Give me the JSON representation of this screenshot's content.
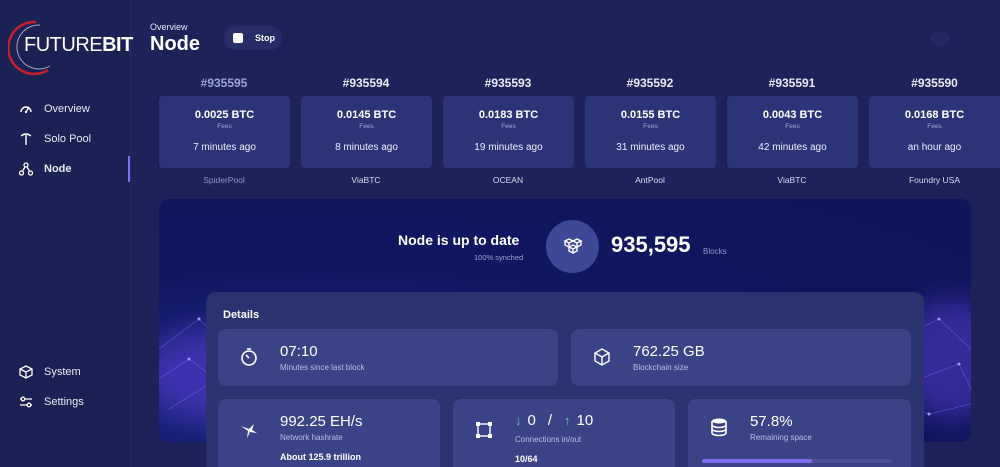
{
  "logo": {
    "text_light": "FUTURE",
    "text_bold": "BIT"
  },
  "sidebar": {
    "items": [
      {
        "label": "Overview",
        "icon": "gauge-icon"
      },
      {
        "label": "Solo Pool",
        "icon": "pickaxe-icon"
      },
      {
        "label": "Node",
        "icon": "network-icon",
        "active": true
      },
      {
        "label": "System",
        "icon": "cube-icon"
      },
      {
        "label": "Settings",
        "icon": "sliders-icon"
      }
    ]
  },
  "header": {
    "breadcrumb": "Overview",
    "title": "Node",
    "stop_label": "Stop"
  },
  "blocks": [
    {
      "number": "#935595",
      "amount": "0.0025 BTC",
      "fees_label": "Fees",
      "time": "7 minutes ago",
      "pool": "SpiderPool"
    },
    {
      "number": "#935594",
      "amount": "0.0145 BTC",
      "fees_label": "Fees",
      "time": "8 minutes ago",
      "pool": "ViaBTC"
    },
    {
      "number": "#935593",
      "amount": "0.0183 BTC",
      "fees_label": "Fees",
      "time": "19 minutes ago",
      "pool": "OCEAN"
    },
    {
      "number": "#935592",
      "amount": "0.0155 BTC",
      "fees_label": "Fees",
      "time": "31 minutes ago",
      "pool": "AntPool"
    },
    {
      "number": "#935591",
      "amount": "0.0043 BTC",
      "fees_label": "Fees",
      "time": "42 minutes ago",
      "pool": "ViaBTC"
    },
    {
      "number": "#935590",
      "amount": "0.0168 BTC",
      "fees_label": "Fees",
      "time": "an hour ago",
      "pool": "Foundry USA"
    }
  ],
  "sync": {
    "title": "Node is up to date",
    "subtitle": "100% synched",
    "height": "935,595",
    "height_unit": "Blocks"
  },
  "details": {
    "title": "Details",
    "last_block": {
      "value": "07:10",
      "label": "Minutes since last block"
    },
    "blockchain_size": {
      "value": "762.25 GB",
      "label": "Blockchain size"
    },
    "hashrate": {
      "value": "992.25 EH/s",
      "label": "Network hashrate",
      "extra": "About 125.9 trillion"
    },
    "connections": {
      "in": "0",
      "separator": "/",
      "out": "10",
      "label": "Connections in/out",
      "extra": "10/64"
    },
    "space": {
      "value": "57.8%",
      "label": "Remaining space",
      "fraction": 0.578
    }
  },
  "colors": {
    "background": "#1d2358",
    "card": "#2c3478",
    "accent": "#7c6cf2",
    "logo_ring": "#c8202a"
  }
}
